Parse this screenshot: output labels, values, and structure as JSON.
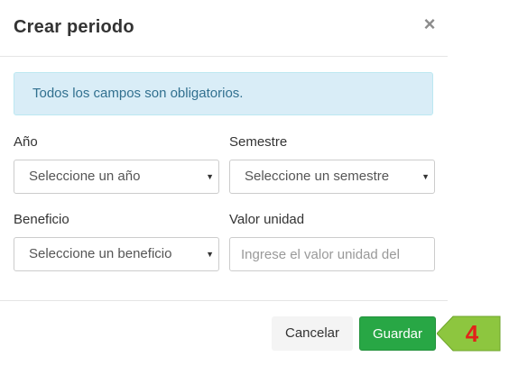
{
  "modal": {
    "title": "Crear periodo",
    "close_symbol": "×",
    "alert_text": "Todos los campos son obligatorios."
  },
  "form": {
    "year": {
      "label": "Año",
      "value": "Seleccione un año"
    },
    "semester": {
      "label": "Semestre",
      "value": "Seleccione un semestre"
    },
    "benefit": {
      "label": "Beneficio",
      "value": "Seleccione un beneficio"
    },
    "unit_value": {
      "label": "Valor unidad",
      "placeholder": "Ingrese el valor unidad del"
    },
    "caret_symbol": "▼"
  },
  "footer": {
    "cancel_label": "Cancelar",
    "save_label": "Guardar"
  },
  "callout": {
    "number": "4",
    "color": "#8dc63f",
    "number_color": "#e2231a"
  },
  "colors": {
    "alert_bg": "#d9edf7",
    "alert_text": "#31708f",
    "save_button": "#28a745"
  }
}
